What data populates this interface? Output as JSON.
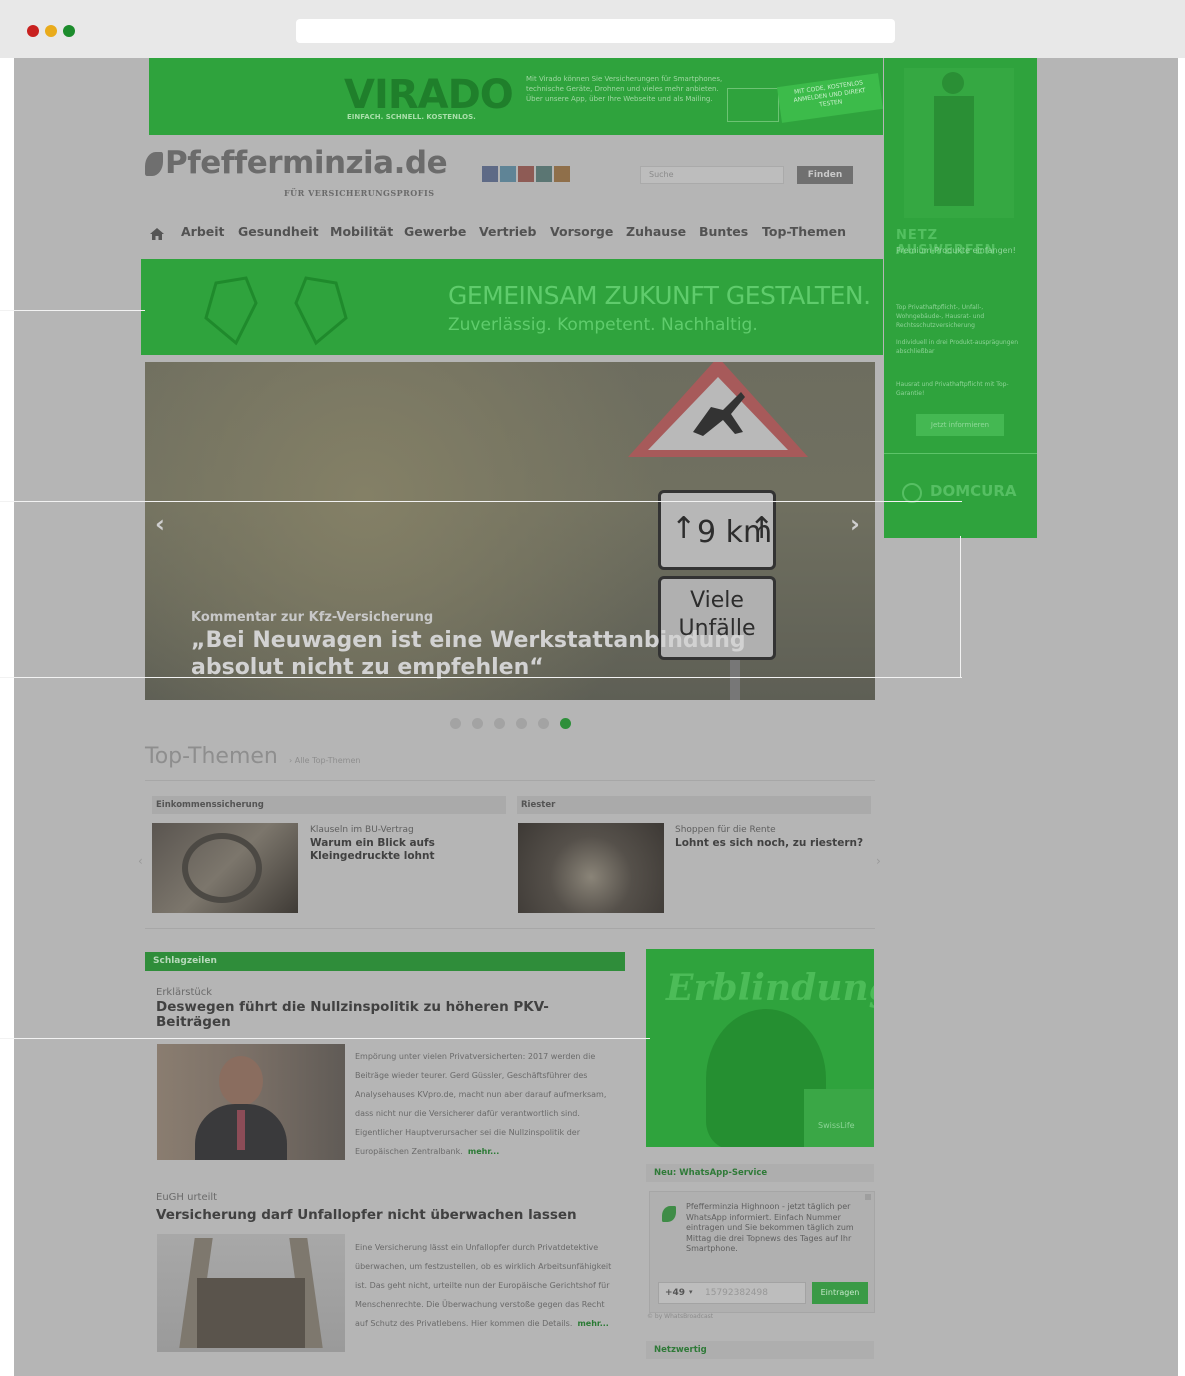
{
  "browser": {
    "url": ""
  },
  "ads": {
    "top_banner": {
      "brand": "VIRADO",
      "tagline": "EINFACH. SCHNELL. KOSTENLOS.",
      "text": "Mit Virado können Sie Versicherungen für Smartphones, technische Geräte, Drohnen und vieles mehr anbieten. Über unsere App, über Ihre Webseite und als Mailing.",
      "badge": "MIT CODE, KOSTENLOS ANMELDEN UND DIREKT TESTEN"
    },
    "side": {
      "headline": "NETZ AUSWERFEN",
      "sub": "Premium-Produkte einfangen!",
      "lines": [
        "Top Privathaftpflicht-, Unfall-, Wohngebäude-, Hausrat- und Rechtsschutzversicherung",
        "Individuell in drei Produkt-ausprägungen abschließbar",
        "Hausrat und Privathaftpflicht mit Top-Garantie!"
      ],
      "button": "Jetzt informieren",
      "logo": "DOMCURA"
    },
    "wide": {
      "title": "GEMEINSAM ZUKUNFT GESTALTEN.",
      "subtitle": "Zuverlässig. Kompetent. Nachhaltig."
    },
    "box": {
      "title": "Erblindung.",
      "logo": "SwissLife"
    }
  },
  "header": {
    "logo": "Pfefferminzia.de",
    "logo_sub": "Für Versicherungsprofis",
    "search_placeholder": "Suche",
    "search_button": "Finden"
  },
  "nav": {
    "items": [
      "Arbeit",
      "Gesundheit",
      "Mobilität",
      "Gewerbe",
      "Vertrieb",
      "Vorsorge",
      "Zuhause",
      "Buntes",
      "Top-Themen"
    ]
  },
  "hero": {
    "kicker": "Kommentar zur Kfz-Versicherung",
    "title": "„Bei Neuwagen ist eine Werkstattanbindung absolut nicht zu empfehlen“",
    "sign_distance": "9 km",
    "sign_text": "Viele Unfälle",
    "dots": 6,
    "active_dot": 6
  },
  "top_themen": {
    "title": "Top-Themen",
    "link": "› Alle Top-Themen",
    "cards": [
      {
        "category": "Einkommenssicherung",
        "kicker": "Klauseln im BU-Vertrag",
        "title": "Warum ein Blick aufs Kleingedruckte lohnt"
      },
      {
        "category": "Riester",
        "kicker": "Shoppen für die Rente",
        "title": "Lohnt es sich noch, zu riestern?"
      }
    ]
  },
  "schlagzeilen": {
    "label": "Schlagzeilen",
    "articles": [
      {
        "kicker": "Erklärstück",
        "title": "Deswegen führt die Nullzinspolitik zu höheren PKV-Beiträgen",
        "text": "Empörung unter vielen Privatversicherten: 2017 werden die Beiträge wieder teurer. Gerd Güssler, Geschäftsführer des Analysehauses KVpro.de, macht nun aber darauf aufmerksam, dass nicht nur die Versicherer dafür verantwortlich sind. Eigentlicher Hauptverursacher sei die Nullzinspolitik der Europäischen Zentralbank.",
        "more": "mehr..."
      },
      {
        "kicker": "EuGH urteilt",
        "title": "Versicherung darf Unfallopfer nicht überwachen lassen",
        "text": "Eine Versicherung lässt ein Unfallopfer durch Privatdetektive überwachen, um festzustellen, ob es wirklich Arbeitsunfähigkeit ist. Das geht nicht, urteilte nun der Europäische Gerichtshof für Menschenrechte. Die Überwachung verstoße gegen das Recht auf Schutz des Privatlebens. Hier kommen die Details.",
        "more": "mehr..."
      }
    ]
  },
  "whatsapp": {
    "title": "Neu: WhatsApp-Service",
    "text": "Pfefferminzia Highnoon - jetzt täglich per WhatsApp informiert. Einfach Nummer eintragen und Sie bekommen täglich zum Mittag die drei Topnews des Tages auf Ihr Smartphone.",
    "prefix": "+49",
    "phone_placeholder": "15792382498",
    "button": "Eintragen",
    "by": "© by WhatsBroadcast"
  },
  "netzwertig": {
    "title": "Netzwertig"
  },
  "colors": {
    "accent": "#2fa33d",
    "overlay": "#b5b5b5"
  }
}
